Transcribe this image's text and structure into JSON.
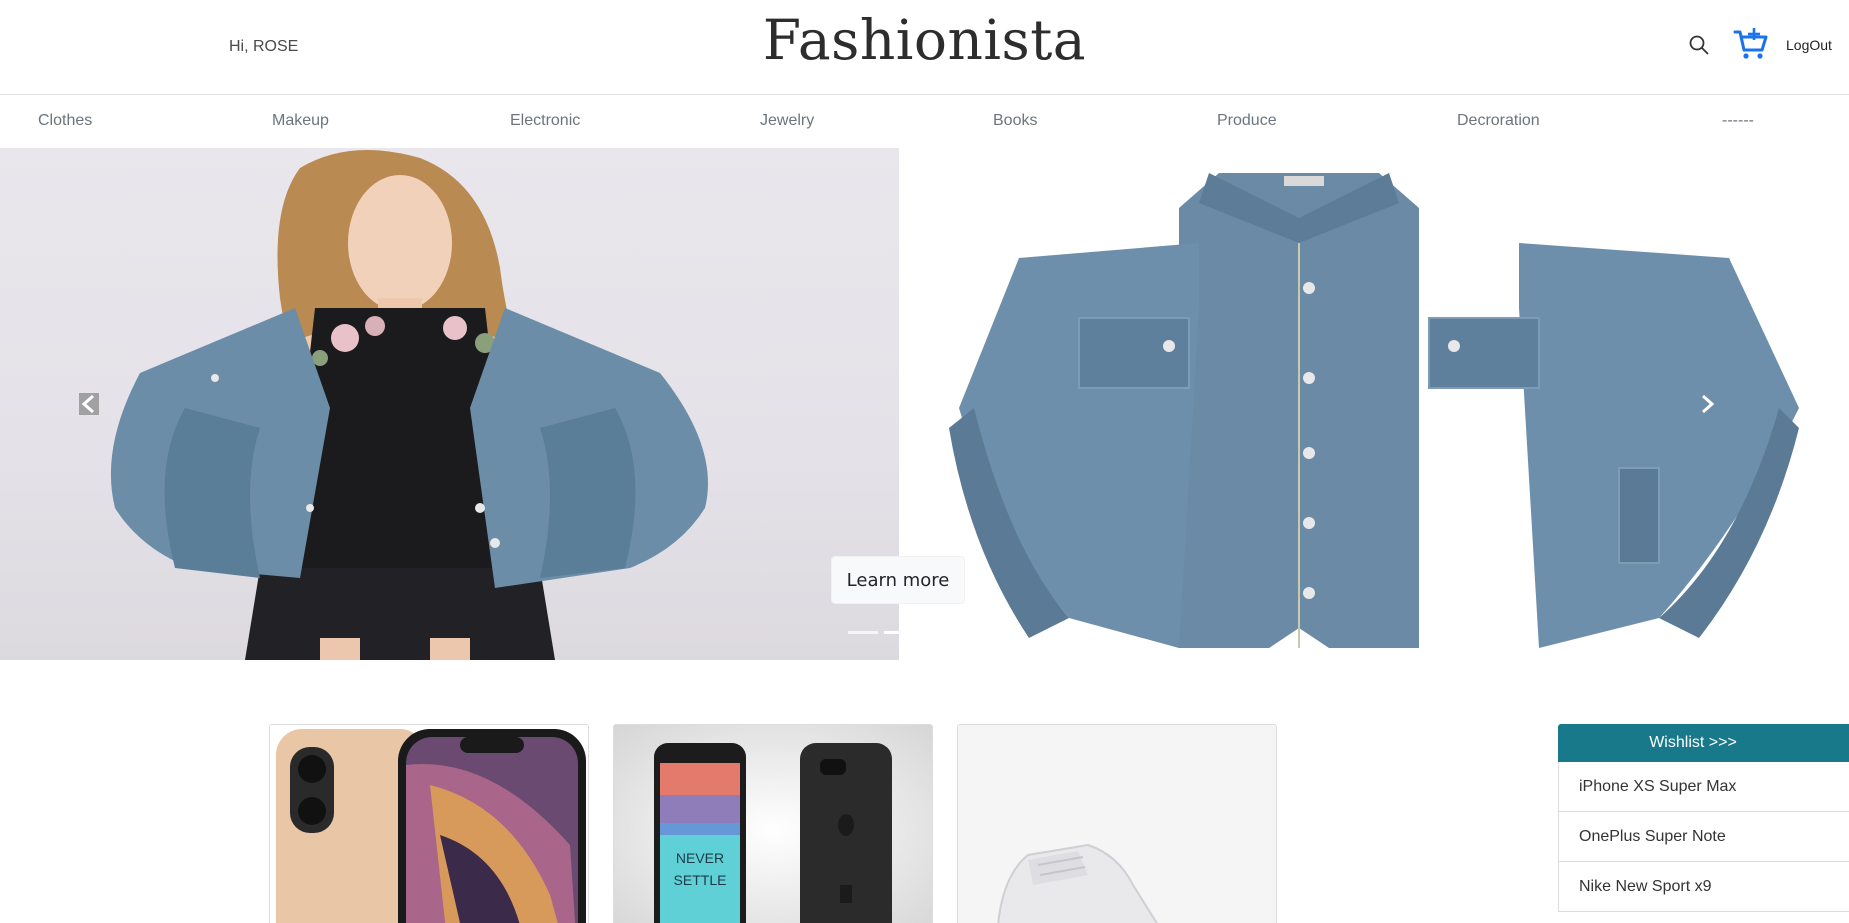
{
  "header": {
    "greeting": "Hi, ROSE",
    "brand": "Fashionista",
    "logout_label": "LogOut",
    "search_icon": "search-icon",
    "cart_icon": "cart-add-icon",
    "accent_color": "#1a73e8"
  },
  "nav": {
    "items": [
      "Clothes",
      "Makeup",
      "Electronic",
      "Jewelry",
      "Books",
      "Produce",
      "Decroration",
      "------"
    ]
  },
  "carousel": {
    "button_label": "Learn more",
    "prev_icon": "chevron-left-icon",
    "next_icon": "chevron-right-icon",
    "slide_count": 2
  },
  "products": [
    {
      "name": "iPhone XS Super Max"
    },
    {
      "name": "OnePlus Super Note"
    },
    {
      "name": "Nike New Sport x9"
    }
  ],
  "wishlist": {
    "header": "Wishlist >>>",
    "header_color": "#17798a",
    "items": [
      "iPhone XS Super Max",
      "OnePlus Super Note",
      "Nike New Sport x9"
    ]
  }
}
